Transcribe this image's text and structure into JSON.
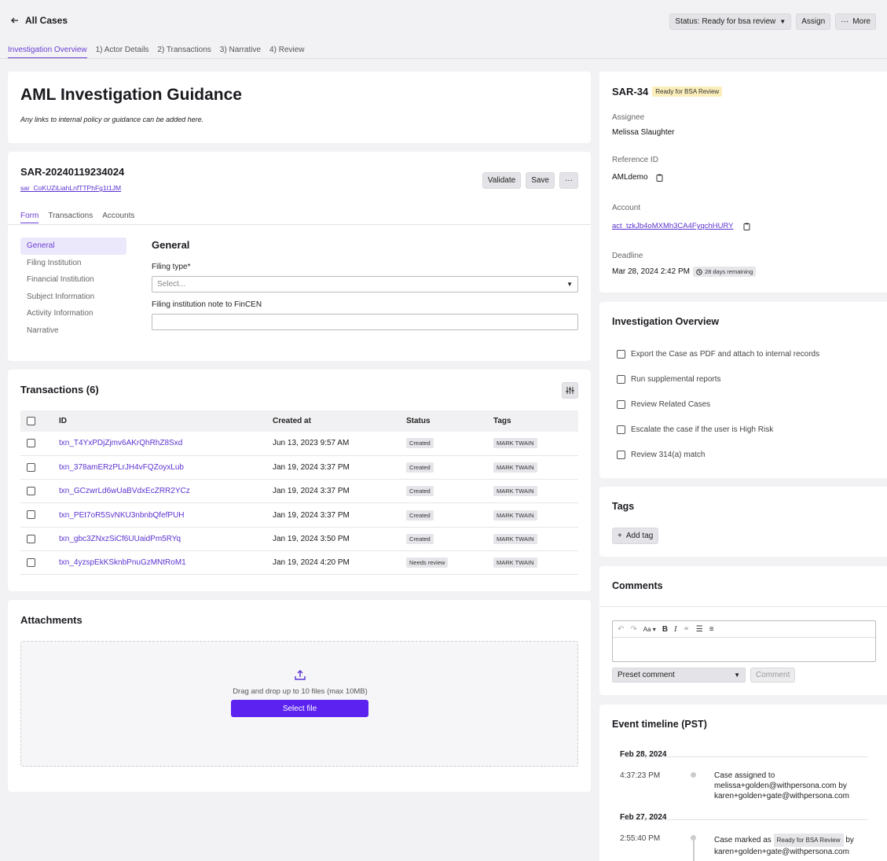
{
  "header": {
    "back_label": "All Cases",
    "status_label": "Status: Ready for bsa review",
    "assign_label": "Assign",
    "more_label": "More"
  },
  "tabs": [
    {
      "label": "Investigation Overview"
    },
    {
      "label": "1) Actor Details"
    },
    {
      "label": "2) Transactions"
    },
    {
      "label": "3) Narrative"
    },
    {
      "label": "4) Review"
    }
  ],
  "guidance": {
    "title": "AML Investigation Guidance",
    "note": "Any links to internal policy or guidance can be added here."
  },
  "sar_form": {
    "title": "SAR-20240119234024",
    "id_link": "sar_CoKUZiLiahLnfTTPhFg1t1JM",
    "validate_label": "Validate",
    "save_label": "Save",
    "sub_tabs": [
      {
        "label": "Form"
      },
      {
        "label": "Transactions"
      },
      {
        "label": "Accounts"
      }
    ],
    "nav": [
      {
        "label": "General"
      },
      {
        "label": "Filing Institution"
      },
      {
        "label": "Financial Institution"
      },
      {
        "label": "Subject Information"
      },
      {
        "label": "Activity Information"
      },
      {
        "label": "Narrative"
      }
    ],
    "section_title": "General",
    "filing_type_label": "Filing type*",
    "filing_type_placeholder": "Select...",
    "note_label": "Filing institution note to FinCEN",
    "note_value": ""
  },
  "transactions": {
    "title": "Transactions (6)",
    "columns": [
      "ID",
      "Created at",
      "Status",
      "Tags"
    ],
    "rows": [
      {
        "id": "txn_T4YxPDjZjmv6AKrQhRhZ8Sxd",
        "created": "Jun 13, 2023 9:57 AM",
        "status": "Created",
        "tag": "MARK TWAIN"
      },
      {
        "id": "txn_378amERzPLrJH4vFQZoyxLub",
        "created": "Jan 19, 2024 3:37 PM",
        "status": "Created",
        "tag": "MARK TWAIN"
      },
      {
        "id": "txn_GCzwrLd6wUaBVdxEcZRR2YCz",
        "created": "Jan 19, 2024 3:37 PM",
        "status": "Created",
        "tag": "MARK TWAIN"
      },
      {
        "id": "txn_PEt7oR5SvNKU3nbnbQfefPUH",
        "created": "Jan 19, 2024 3:37 PM",
        "status": "Created",
        "tag": "MARK TWAIN"
      },
      {
        "id": "txn_gbc3ZNxzSiCf6UUaidPm5RYq",
        "created": "Jan 19, 2024 3:50 PM",
        "status": "Created",
        "tag": "MARK TWAIN"
      },
      {
        "id": "txn_4yzspEkKSknbPnuGzMNtRoM1",
        "created": "Jan 19, 2024 4:20 PM",
        "status": "Needs review",
        "tag": "MARK TWAIN"
      }
    ]
  },
  "attachments": {
    "title": "Attachments",
    "drop_text": "Drag and drop up to 10 files (max 10MB)",
    "select_label": "Select file"
  },
  "case": {
    "id": "SAR-34",
    "badge": "Ready for BSA Review",
    "assignee_label": "Assignee",
    "assignee": "Melissa Slaughter",
    "ref_label": "Reference ID",
    "ref": "AMLdemo",
    "account_label": "Account",
    "account": "act_tzkJb4oMXMh3CA4FyqchHURY",
    "deadline_label": "Deadline",
    "deadline": "Mar 28, 2024 2:42 PM",
    "remaining": "28 days remaining"
  },
  "overview": {
    "title": "Investigation Overview",
    "items": [
      {
        "label": "Export the Case as PDF and attach to internal records"
      },
      {
        "label": "Run supplemental reports"
      },
      {
        "label": "Review Related Cases"
      },
      {
        "label": "Escalate the case if the user is High Risk"
      },
      {
        "label": "Review 314(a) match"
      }
    ]
  },
  "tags": {
    "title": "Tags",
    "add_label": "Add tag"
  },
  "comments": {
    "title": "Comments",
    "preset_label": "Preset comment",
    "comment_label": "Comment",
    "font_label": "Aa"
  },
  "timeline": {
    "title": "Event timeline (PST)",
    "groups": [
      {
        "date": "Feb 28, 2024",
        "time": "4:37:23 PM",
        "line1": "Case assigned to",
        "line2": "melissa+golden@withpersona.com by",
        "line3": "karen+golden+gate@withpersona.com"
      },
      {
        "date": "Feb 27, 2024",
        "time": "2:55:40 PM",
        "line1": "Case marked as",
        "badge": "Ready for BSA Review",
        "line1b": "by",
        "line2": "karen+golden+gate@withpersona.com"
      }
    ]
  }
}
